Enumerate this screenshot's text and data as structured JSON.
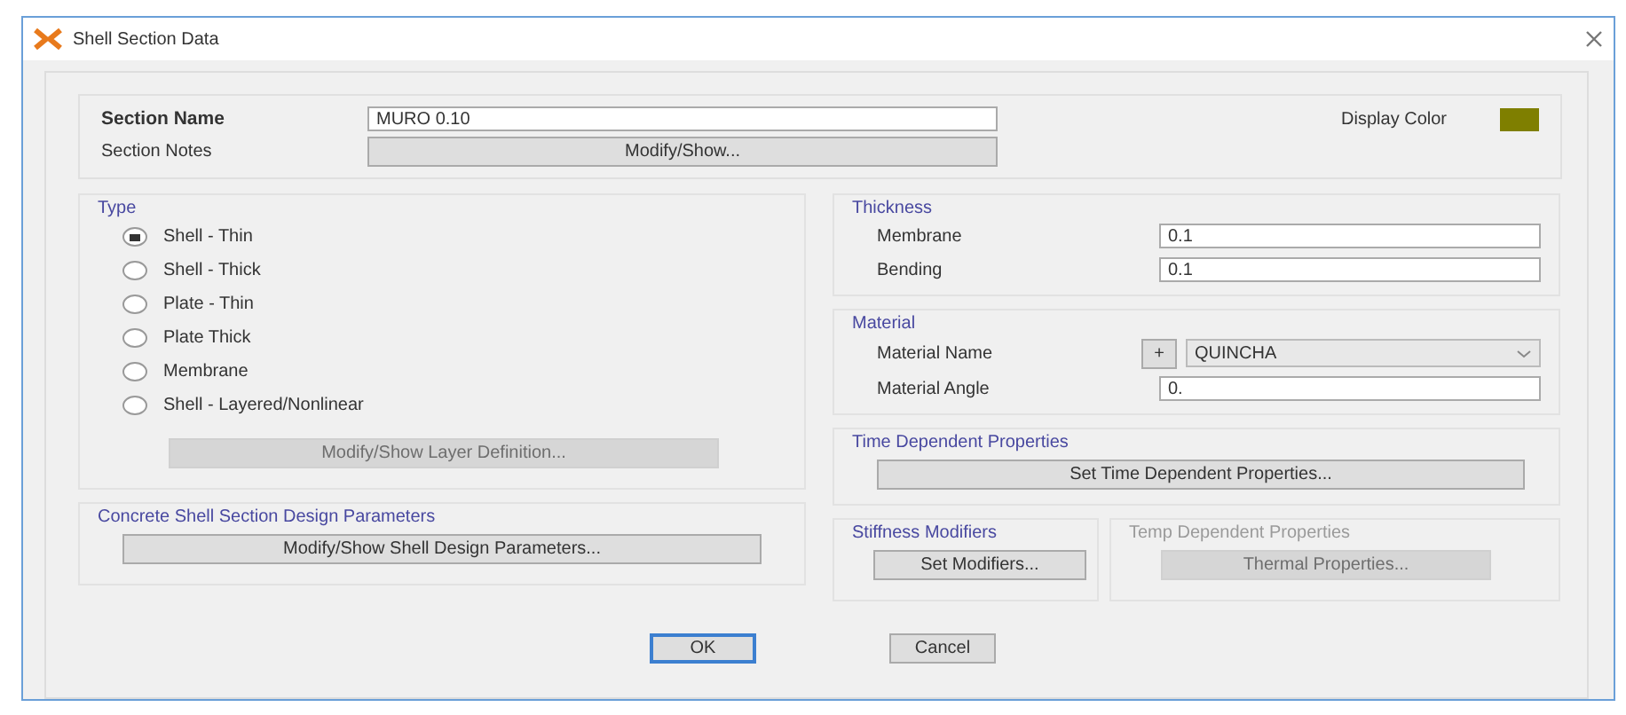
{
  "window": {
    "title": "Shell Section Data"
  },
  "section": {
    "name_label": "Section Name",
    "name_value": "MURO 0.10",
    "notes_label": "Section Notes",
    "notes_button": "Modify/Show...",
    "color_label": "Display Color",
    "color": "#7f7f00"
  },
  "type": {
    "title": "Type",
    "options": [
      {
        "label": "Shell - Thin",
        "selected": true
      },
      {
        "label": "Shell - Thick",
        "selected": false
      },
      {
        "label": "Plate - Thin",
        "selected": false
      },
      {
        "label": "Plate Thick",
        "selected": false
      },
      {
        "label": "Membrane",
        "selected": false
      },
      {
        "label": "Shell - Layered/Nonlinear",
        "selected": false
      }
    ],
    "layer_button": {
      "label": "Modify/Show Layer Definition...",
      "disabled": true
    }
  },
  "concrete": {
    "title": "Concrete Shell Section Design Parameters",
    "button": "Modify/Show Shell Design Parameters..."
  },
  "thickness": {
    "title": "Thickness",
    "rows": [
      {
        "label": "Membrane",
        "value": "0.1"
      },
      {
        "label": "Bending",
        "value": "0.1"
      }
    ]
  },
  "material": {
    "title": "Material",
    "name_label": "Material Name",
    "add_button": "+",
    "name_value": "QUINCHA",
    "angle_label": "Material Angle",
    "angle_value": "0."
  },
  "time_dependent": {
    "title": "Time Dependent Properties",
    "button": "Set Time Dependent Properties..."
  },
  "stiffness": {
    "title": "Stiffness Modifiers",
    "button": "Set Modifiers...",
    "disabled": false
  },
  "temp_dependent": {
    "title": "Temp Dependent Properties",
    "button": "Thermal Properties...",
    "disabled": true
  },
  "buttons": [
    {
      "label": "OK",
      "default": true
    },
    {
      "label": "Cancel",
      "default": false
    }
  ]
}
